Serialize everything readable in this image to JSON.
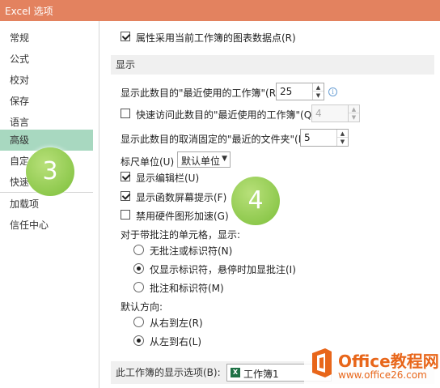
{
  "window": {
    "title": "Excel 选项"
  },
  "sidebar": {
    "items": [
      {
        "label": "常规"
      },
      {
        "label": "公式"
      },
      {
        "label": "校对"
      },
      {
        "label": "保存"
      },
      {
        "label": "语言"
      },
      {
        "label": "高级",
        "active": true
      },
      {
        "label": "自定"
      },
      {
        "label": "快速"
      },
      {
        "label": "加载项"
      },
      {
        "label": "信任中心"
      }
    ]
  },
  "options": {
    "chart_datapoints": {
      "label": "属性采用当前工作簿的图表数据点(R)",
      "checked": true
    },
    "display_header": "显示",
    "recent_workbooks": {
      "label": "显示此数目的\"最近使用的工作簿\"(R):",
      "value": "25"
    },
    "quick_access": {
      "label": "快速访问此数目的\"最近使用的工作簿\"(Q):",
      "value": "4",
      "checked": false
    },
    "unpinned_folders": {
      "label": "显示此数目的取消固定的\"最近的文件夹\"(F):",
      "value": "5"
    },
    "ruler_units": {
      "label": "标尺单位(U)",
      "value": "默认单位"
    },
    "show_formula_bar": {
      "label": "显示编辑栏(U)",
      "checked": true
    },
    "show_function_tips": {
      "label": "显示函数屏幕提示(F)",
      "checked": true
    },
    "disable_hw_accel": {
      "label": "禁用硬件图形加速(G)",
      "checked": false
    },
    "comments_label": "对于带批注的单元格，显示:",
    "comments_options": [
      {
        "label": "无批注或标识符(N)",
        "checked": false
      },
      {
        "label": "仅显示标识符，悬停时加显批注(I)",
        "checked": true
      },
      {
        "label": "批注和标识符(M)",
        "checked": false
      }
    ],
    "direction_label": "默认方向:",
    "direction_options": [
      {
        "label": "从右到左(R)",
        "checked": false
      },
      {
        "label": "从左到右(L)",
        "checked": true
      }
    ],
    "workbook_display": {
      "label": "此工作簿的显示选项(B):",
      "value": "工作簿1",
      "icon": "excel-icon"
    }
  },
  "callouts": {
    "step3": "3",
    "step4": "4",
    "color": "#8ccc4a"
  },
  "watermark": {
    "title": "Office教程网",
    "url": "www.office26.com",
    "color": "#e8661a"
  }
}
